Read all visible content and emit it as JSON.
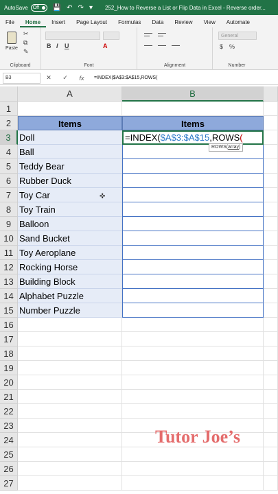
{
  "titlebar": {
    "autosave_label": "AutoSave",
    "autosave_state": "Off",
    "filename": "252_How to Reverse a List or Flip Data in Excel - Reverse order..."
  },
  "tabs": [
    "File",
    "Home",
    "Insert",
    "Page Layout",
    "Formulas",
    "Data",
    "Review",
    "View",
    "Automate"
  ],
  "active_tab": "Home",
  "ribbon": {
    "paste_label": "Paste",
    "groups": [
      "Clipboard",
      "Font",
      "Alignment",
      "Number"
    ],
    "number_format": "General"
  },
  "formula_bar": {
    "name_box": "B3",
    "cancel_symbol": "✕",
    "enter_symbol": "✓",
    "fx_symbol": "fx",
    "formula": "=INDEX($A$3:$A$15,ROWS("
  },
  "columns": [
    "A",
    "B"
  ],
  "rows": [
    "1",
    "2",
    "3",
    "4",
    "5",
    "6",
    "7",
    "8",
    "9",
    "10",
    "11",
    "12",
    "13",
    "14",
    "15",
    "16",
    "17",
    "18",
    "19",
    "20",
    "21",
    "22",
    "23",
    "24",
    "25",
    "26",
    "27"
  ],
  "headers": {
    "a": "Items",
    "b": "Items"
  },
  "items": [
    "Doll",
    "Ball",
    "Teddy Bear",
    "Rubber Duck",
    "Toy Car",
    "Toy Train",
    "Balloon",
    "Sand Bucket",
    "Toy Aeroplane",
    "Rocking Horse",
    "Building Block",
    "Alphabet Puzzle",
    "Number Puzzle"
  ],
  "active_cell": {
    "prefix": "=INDEX(",
    "range": "$A$3:$A$15",
    "func": ",ROWS",
    "paren": "("
  },
  "tooltip": {
    "func": "ROWS(",
    "arg": "array",
    "close": ")"
  },
  "watermark": "Tutor Joe’s",
  "colors": {
    "excel_green": "#217346",
    "header_fill": "#8ea9db",
    "column_a_fill": "#e6ecf7",
    "table_border": "#4472c4",
    "watermark": "#e46d6d"
  }
}
